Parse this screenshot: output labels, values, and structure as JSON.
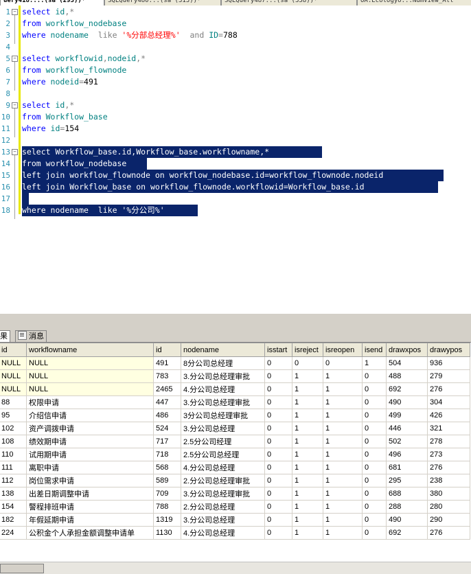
{
  "tabs": [
    {
      "label": "uery418....(sa (293))*",
      "active": true
    },
    {
      "label": "SQLQuery480...(sa (313))*",
      "active": false
    },
    {
      "label": "SQLQuery487...(sa (358))*",
      "active": false
    },
    {
      "label": "OA.Ecologyo...NumView_All",
      "active": false
    }
  ],
  "editor": {
    "lines": [
      {
        "n": "1",
        "fold": "minus",
        "tokens": [
          [
            "kw",
            "select "
          ],
          [
            "id",
            "id"
          ],
          [
            "op",
            ","
          ],
          [
            "op",
            "*"
          ]
        ]
      },
      {
        "n": "2",
        "fold": "",
        "tokens": [
          [
            "kw",
            "from "
          ],
          [
            "id",
            "workflow_nodebase"
          ]
        ]
      },
      {
        "n": "3",
        "fold": "",
        "tokens": [
          [
            "kw",
            "where "
          ],
          [
            "id",
            "nodename  "
          ],
          [
            "op",
            "like "
          ],
          [
            "str",
            "'%分部总经理%'"
          ],
          [
            "",
            "  "
          ],
          [
            "op",
            "and "
          ],
          [
            "id",
            "ID"
          ],
          [
            "op",
            "="
          ],
          [
            "",
            "788"
          ]
        ]
      },
      {
        "n": "4",
        "fold": "",
        "tokens": []
      },
      {
        "n": "5",
        "fold": "minus",
        "tokens": [
          [
            "kw",
            "select "
          ],
          [
            "id",
            "workflowid"
          ],
          [
            "op",
            ","
          ],
          [
            "id",
            "nodeid"
          ],
          [
            "op",
            ","
          ],
          [
            "op",
            "*"
          ]
        ]
      },
      {
        "n": "6",
        "fold": "",
        "tokens": [
          [
            "kw",
            "from "
          ],
          [
            "id",
            "workflow_flownode"
          ]
        ]
      },
      {
        "n": "7",
        "fold": "",
        "tokens": [
          [
            "kw",
            "where "
          ],
          [
            "id",
            "nodeid"
          ],
          [
            "op",
            "="
          ],
          [
            "",
            "491"
          ]
        ]
      },
      {
        "n": "8",
        "fold": "",
        "tokens": []
      },
      {
        "n": "9",
        "fold": "minus",
        "tokens": [
          [
            "kw",
            "select "
          ],
          [
            "id",
            "id"
          ],
          [
            "op",
            ","
          ],
          [
            "op",
            "*"
          ]
        ]
      },
      {
        "n": "10",
        "fold": "",
        "tokens": [
          [
            "kw",
            "from "
          ],
          [
            "id",
            "Workflow_base"
          ]
        ]
      },
      {
        "n": "11",
        "fold": "",
        "tokens": [
          [
            "kw",
            "where "
          ],
          [
            "id",
            "id"
          ],
          [
            "op",
            "="
          ],
          [
            "",
            "154"
          ]
        ]
      },
      {
        "n": "12",
        "fold": "",
        "tokens": []
      },
      {
        "n": "13",
        "fold": "minus",
        "sel": true,
        "tokens": [
          [
            "kw",
            "select "
          ],
          [
            "id",
            "Workflow_base.id"
          ],
          [
            "op",
            ","
          ],
          [
            "id",
            "Workflow_base.workflowname"
          ],
          [
            "op",
            ","
          ],
          [
            "op",
            "*"
          ]
        ]
      },
      {
        "n": "14",
        "fold": "",
        "sel": true,
        "tokens": [
          [
            "kw",
            "from "
          ],
          [
            "id",
            "workflow_nodebase"
          ]
        ]
      },
      {
        "n": "15",
        "fold": "",
        "sel": true,
        "tokens": [
          [
            "op",
            "left join "
          ],
          [
            "id",
            "workflow_flownode "
          ],
          [
            "kw",
            "on "
          ],
          [
            "id",
            "workflow_nodebase.id"
          ],
          [
            "op",
            "="
          ],
          [
            "id",
            "workflow_flownode.nodeid"
          ]
        ]
      },
      {
        "n": "16",
        "fold": "",
        "sel": true,
        "tokens": [
          [
            "op",
            "left join "
          ],
          [
            "id",
            "Workflow_base "
          ],
          [
            "kw",
            "on "
          ],
          [
            "id",
            "workflow_flownode.workflowid"
          ],
          [
            "op",
            "="
          ],
          [
            "id",
            "Workflow_base.id"
          ]
        ]
      },
      {
        "n": "17",
        "fold": "",
        "sel": true,
        "tokens": [
          [
            "",
            " "
          ]
        ]
      },
      {
        "n": "18",
        "fold": "",
        "sel": true,
        "tokens": [
          [
            "kw",
            "where "
          ],
          [
            "id",
            "nodename  "
          ],
          [
            "op",
            "like "
          ],
          [
            "str",
            "'%分公司%'"
          ]
        ]
      }
    ]
  },
  "results_tabs": [
    {
      "label": "果",
      "active": true,
      "icon": "grid-icon"
    },
    {
      "label": "消息",
      "active": false,
      "icon": "message-icon"
    }
  ],
  "grid": {
    "columns": [
      "id",
      "workflowname",
      "id",
      "nodename",
      "isstart",
      "isreject",
      "isreopen",
      "isend",
      "drawxpos",
      "drawypos"
    ],
    "rows": [
      [
        "NULL",
        "NULL",
        "491",
        "8分公司总经理",
        "0",
        "0",
        "0",
        "1",
        "504",
        "936"
      ],
      [
        "NULL",
        "NULL",
        "783",
        "3.分公司总经理审批",
        "0",
        "1",
        "1",
        "0",
        "488",
        "279"
      ],
      [
        "NULL",
        "NULL",
        "2465",
        "4.分公司总经理",
        "0",
        "1",
        "1",
        "0",
        "692",
        "276"
      ],
      [
        "88",
        "权限申请",
        "447",
        "3.分公司总经理审批",
        "0",
        "1",
        "1",
        "0",
        "490",
        "304"
      ],
      [
        "95",
        "介绍信申请",
        "486",
        "3分公司总经理审批",
        "0",
        "1",
        "1",
        "0",
        "499",
        "426"
      ],
      [
        "102",
        "资产调拨申请",
        "524",
        "3.分公司总经理",
        "0",
        "1",
        "1",
        "0",
        "446",
        "321"
      ],
      [
        "108",
        "绩效期申请",
        "717",
        "2.5分公司经理",
        "0",
        "1",
        "1",
        "0",
        "502",
        "278"
      ],
      [
        "110",
        "试用期申请",
        "718",
        "2.5分公司总经理",
        "0",
        "1",
        "1",
        "0",
        "496",
        "273"
      ],
      [
        "111",
        "离职申请",
        "568",
        "4.分公司总经理",
        "0",
        "1",
        "1",
        "0",
        "681",
        "276"
      ],
      [
        "112",
        "岗位需求申请",
        "589",
        "2.分公司总经理审批",
        "0",
        "1",
        "1",
        "0",
        "295",
        "238"
      ],
      [
        "138",
        "出差日期调整申请",
        "709",
        "3.分公司总经理审批",
        "0",
        "1",
        "1",
        "0",
        "688",
        "380"
      ],
      [
        "154",
        "警程排班申请",
        "788",
        "2.分公司总经理",
        "0",
        "1",
        "1",
        "0",
        "288",
        "280"
      ],
      [
        "182",
        "年假延期申请",
        "1319",
        "3.分公司总经理",
        "0",
        "1",
        "1",
        "0",
        "490",
        "290"
      ],
      [
        "224",
        "公积金个人承担金额调整申请单",
        "1130",
        "4.分公司总经理",
        "0",
        "1",
        "1",
        "0",
        "692",
        "276"
      ]
    ]
  }
}
